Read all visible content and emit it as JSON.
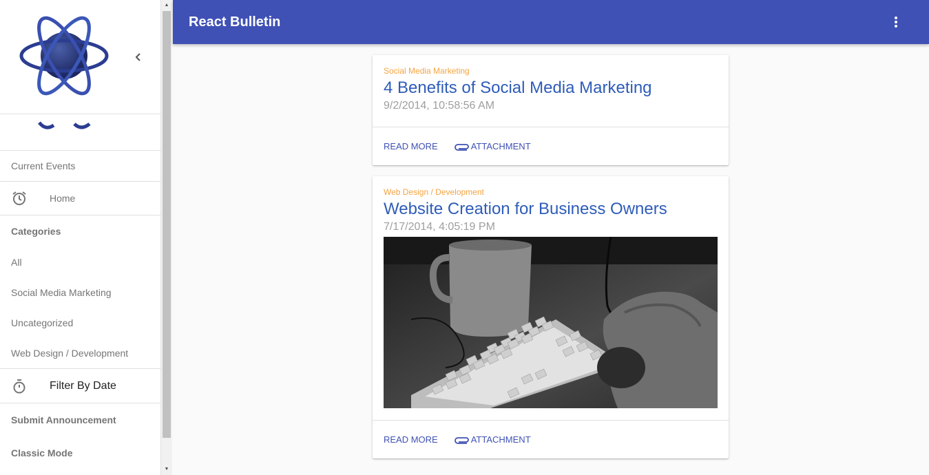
{
  "app": {
    "title": "React Bulletin"
  },
  "sidebar": {
    "items": [
      {
        "label": "Current Events"
      },
      {
        "label": "Home"
      },
      {
        "label": "Categories"
      },
      {
        "label": "All"
      },
      {
        "label": "Social Media Marketing"
      },
      {
        "label": "Uncategorized"
      },
      {
        "label": "Web Design / Development"
      },
      {
        "label": "Filter By Date"
      },
      {
        "label": "Submit Announcement"
      },
      {
        "label": "Classic Mode"
      }
    ]
  },
  "posts": [
    {
      "category": "Social Media Marketing",
      "title": "4 Benefits of Social Media Marketing",
      "date": "9/2/2014, 10:58:56 AM",
      "read_more": "READ MORE",
      "attachment": "ATTACHMENT"
    },
    {
      "category": "Web Design / Development",
      "title": "Website Creation for Business Owners",
      "date": "7/17/2014, 4:05:19 PM",
      "read_more": "READ MORE",
      "attachment": "ATTACHMENT"
    }
  ],
  "colors": {
    "primary": "#3f51b5",
    "category": "#f4a340",
    "title_link": "#2e5cb8"
  },
  "icons": {
    "collapse": "chevron-left-icon",
    "home": "alarm-clock-icon",
    "filter_date": "stopwatch-icon",
    "menu": "more-vert-icon",
    "attachment": "paperclip-icon"
  }
}
